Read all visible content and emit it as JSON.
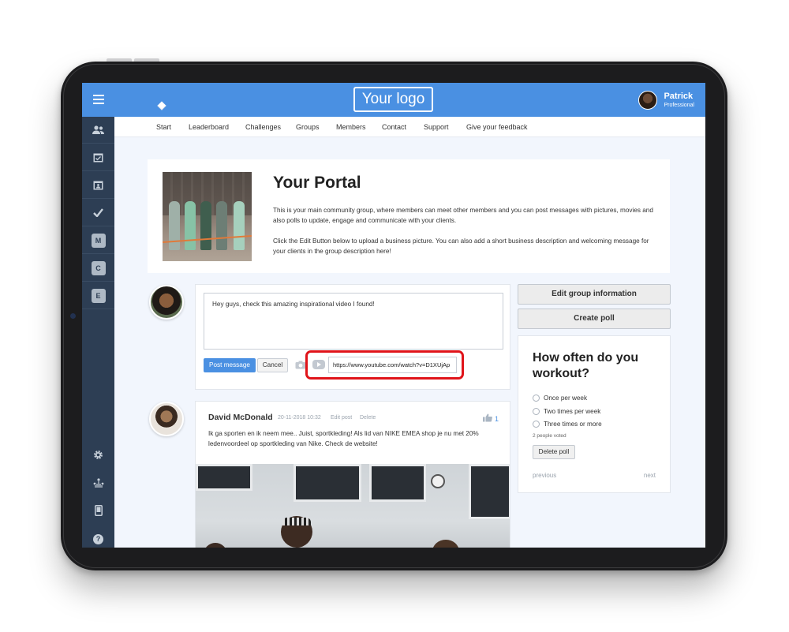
{
  "header": {
    "logo": "Your logo",
    "user_name": "Patrick",
    "user_role": "Professional"
  },
  "sidebar": {
    "items": [
      {
        "icon": "users-icon"
      },
      {
        "icon": "calendar-check-icon"
      },
      {
        "icon": "calendar-user-icon"
      },
      {
        "icon": "checkmark-icon"
      },
      {
        "letter": "M"
      },
      {
        "letter": "C"
      },
      {
        "letter": "E"
      }
    ],
    "bottom": [
      {
        "icon": "gear-icon"
      },
      {
        "icon": "network-icon"
      },
      {
        "icon": "mobile-icon"
      },
      {
        "icon": "help-icon",
        "glyph": "?"
      }
    ]
  },
  "nav": {
    "items": [
      "Start",
      "Leaderboard",
      "Challenges",
      "Groups",
      "Members",
      "Contact",
      "Support",
      "Give your feedback"
    ]
  },
  "portal": {
    "title": "Your Portal",
    "p1": "This is your main community group, where members can meet other members and you can post messages with pictures, movies and also polls to update, engage and communicate with your clients.",
    "p2": "Click the Edit Button below to upload a business picture. You can also add a short business description and welcoming message for your clients in the group description here!"
  },
  "composer": {
    "text": "Hey guys, check this amazing inspirational video I found!",
    "post_label": "Post message",
    "cancel_label": "Cancel",
    "url_value": "https://www.youtube.com/watch?v=D1XUjAp"
  },
  "feed": {
    "author": "David McDonald",
    "date": "20-11-2018 10:32",
    "edit": "Edit post",
    "delete": "Delete",
    "likes": "1",
    "text": "Ik ga sporten en ik neem mee.. Juist, sportkleding! Als lid van NIKE EMEA shop je nu met 20% ledenvoordeel op sportkleding van Nike. Check de website!"
  },
  "side": {
    "edit_group": "Edit group information",
    "create_poll": "Create poll"
  },
  "poll": {
    "question": "How often do you workout?",
    "options": [
      "Once per week",
      "Two times per week",
      "Three times or more"
    ],
    "voted": "2 people voted",
    "delete_label": "Delete poll",
    "previous": "previous",
    "next": "next"
  },
  "colors": {
    "header": "#4a90e2",
    "sidebar": "#2d3e54",
    "highlight": "#e0141a"
  }
}
